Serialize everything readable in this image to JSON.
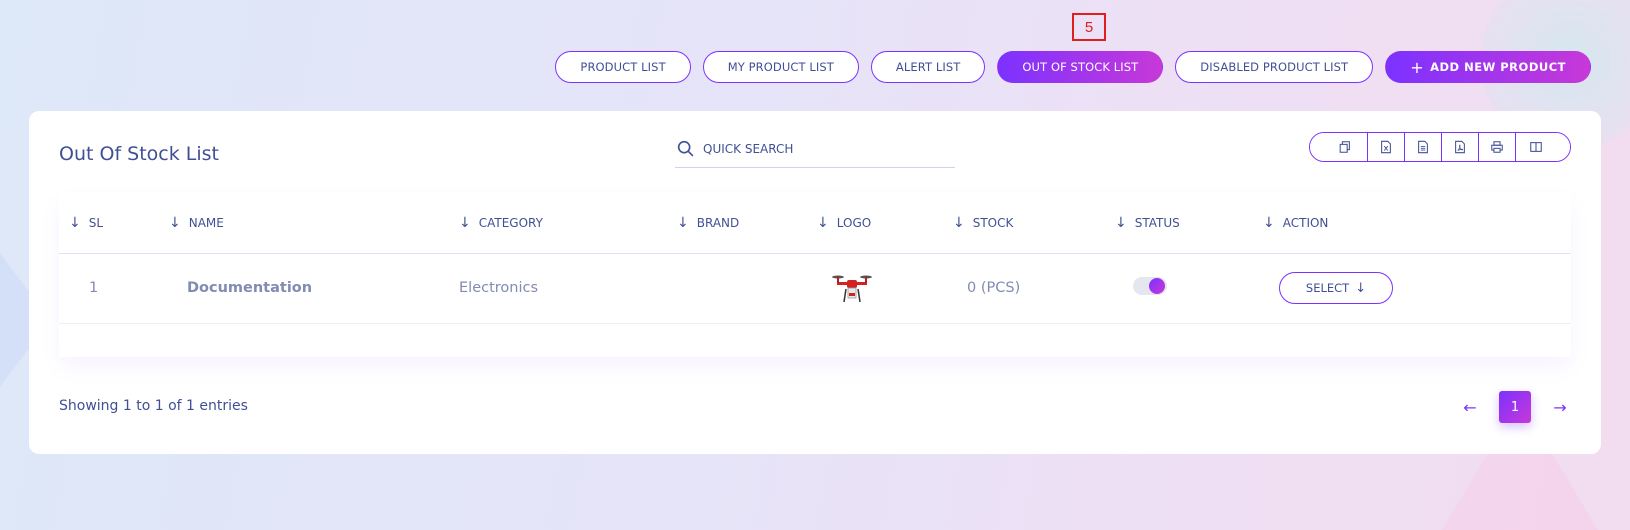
{
  "annotation": {
    "badge": "5"
  },
  "top_nav": {
    "product_list": "PRODUCT LIST",
    "my_product_list": "MY PRODUCT LIST",
    "alert_list": "ALERT LIST",
    "out_of_stock_list": "OUT OF STOCK LIST",
    "disabled_product_list": "DISABLED PRODUCT LIST",
    "add_new_product": "ADD NEW PRODUCT",
    "active_tab": "OUT OF STOCK LIST"
  },
  "card": {
    "title": "Out Of Stock List",
    "search_placeholder": "QUICK SEARCH",
    "export_buttons": [
      "copy-icon",
      "excel-icon",
      "csv-icon",
      "pdf-icon",
      "print-icon",
      "columns-icon"
    ]
  },
  "table": {
    "columns": [
      "SL",
      "NAME",
      "CATEGORY",
      "BRAND",
      "LOGO",
      "STOCK",
      "STATUS",
      "ACTION"
    ],
    "rows": [
      {
        "sl": "1",
        "name": "Documentation",
        "category": "Electronics",
        "brand": "",
        "logo": "drone-product-image",
        "stock": "0 (PCS)",
        "status_on": true,
        "action": "SELECT"
      }
    ]
  },
  "footer": {
    "entries": "Showing 1 to 1 of 1 entries",
    "current_page": "1",
    "prev": "←",
    "next": "→"
  },
  "colors": {
    "accent_start": "#7c32ff",
    "accent_end": "#c738d8",
    "text": "#415094",
    "muted": "#828bb2",
    "annotation_red": "#e0201c"
  }
}
